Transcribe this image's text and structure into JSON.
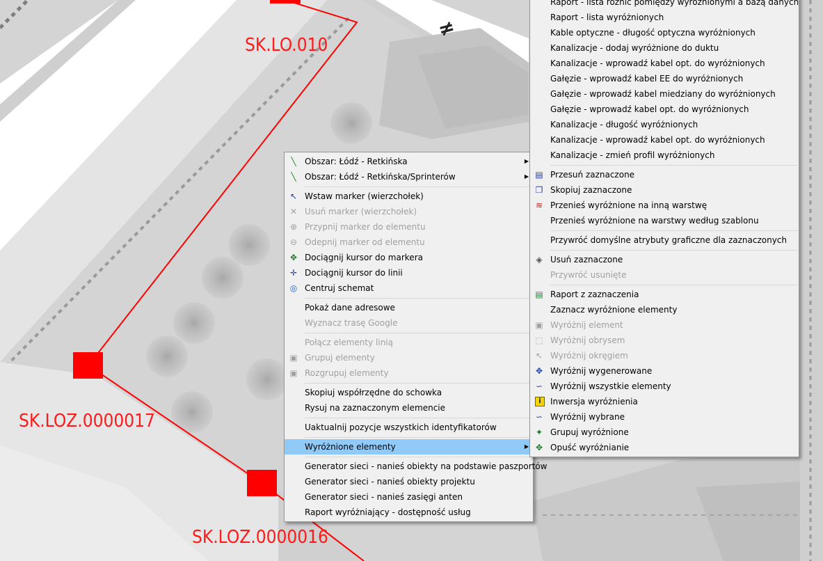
{
  "map": {
    "labels": [
      "SK.LO.010",
      "SK.LOZ.0000017",
      "SK.LOZ.0000016"
    ],
    "not_equal_symbol": "≠",
    "accent_color": "#ff0000"
  },
  "context_menu": {
    "items": [
      {
        "label": "Obszar: Łódź - Retkińska",
        "icon": "diagonal-line-icon",
        "glyph": "╲",
        "color": "#1a8a1a",
        "disabled": false,
        "submenu": true
      },
      {
        "label": "Obszar: Łódź - Retkińska/Sprinterów",
        "icon": "diagonal-line-icon",
        "glyph": "╲",
        "color": "#1a8a1a",
        "disabled": false,
        "submenu": true
      },
      {
        "separator": true
      },
      {
        "label": "Wstaw marker (wierzchołek)",
        "icon": "cursor-arrow-icon",
        "glyph": "↖",
        "color": "#1a3fa0",
        "disabled": false
      },
      {
        "label": "Usuń marker (wierzchołek)",
        "icon": "delete-x-icon",
        "glyph": "✕",
        "color": "#a0a0a0",
        "disabled": true
      },
      {
        "label": "Przypnij marker do elementu",
        "icon": "pin-marker-icon",
        "glyph": "⊕",
        "color": "#a0a0a0",
        "disabled": true
      },
      {
        "label": "Odepnij marker od elementu",
        "icon": "unpin-marker-icon",
        "glyph": "⊖",
        "color": "#a0a0a0",
        "disabled": true
      },
      {
        "label": "Dociągnij kursor do markera",
        "icon": "snap-to-marker-icon",
        "glyph": "✥",
        "color": "#1a7a2a",
        "disabled": false
      },
      {
        "label": "Dociągnij kursor do linii",
        "icon": "snap-to-line-icon",
        "glyph": "✛",
        "color": "#1a3fa0",
        "disabled": false
      },
      {
        "label": "Centruj schemat",
        "icon": "center-target-icon",
        "glyph": "◎",
        "color": "#1a5fd0",
        "disabled": false
      },
      {
        "separator": true
      },
      {
        "label": "Pokaż dane adresowe",
        "icon": "",
        "glyph": "",
        "disabled": false
      },
      {
        "label": "Wyznacz trasę Google",
        "icon": "",
        "glyph": "",
        "disabled": true
      },
      {
        "separator": true
      },
      {
        "label": "Połącz elementy linią",
        "icon": "",
        "glyph": "",
        "disabled": true
      },
      {
        "label": "Grupuj elementy",
        "icon": "group-icon",
        "glyph": "▣",
        "color": "#a0a0a0",
        "disabled": true
      },
      {
        "label": "Rozgrupuj elementy",
        "icon": "ungroup-icon",
        "glyph": "▣",
        "color": "#a0a0a0",
        "disabled": true
      },
      {
        "separator": true
      },
      {
        "label": "Skopiuj współrzędne do schowka",
        "icon": "",
        "glyph": "",
        "disabled": false
      },
      {
        "label": "Rysuj na zaznaczonym elemencie",
        "icon": "",
        "glyph": "",
        "disabled": false
      },
      {
        "separator": true
      },
      {
        "label": "Uaktualnij pozycje wszystkich identyfikatorów",
        "icon": "",
        "glyph": "",
        "disabled": false
      },
      {
        "separator": true
      },
      {
        "label": "Wyróżnione elementy",
        "icon": "",
        "glyph": "",
        "disabled": false,
        "submenu": true,
        "highlight": true
      },
      {
        "separator": true
      },
      {
        "label": "Generator sieci - nanieś obiekty na podstawie paszportów",
        "icon": "",
        "glyph": "",
        "disabled": false
      },
      {
        "label": "Generator sieci - nanieś obiekty projektu",
        "icon": "",
        "glyph": "",
        "disabled": false
      },
      {
        "label": "Generator sieci - nanieś zasięgi anten",
        "icon": "",
        "glyph": "",
        "disabled": false
      },
      {
        "label": "Raport wyróżniający - dostępność usług",
        "icon": "",
        "glyph": "",
        "disabled": false
      }
    ]
  },
  "submenu": {
    "items": [
      {
        "label": "Raport - lista różnic pomiędzy wyróżnionymi a bazą danych",
        "icon": "",
        "glyph": "",
        "disabled": false
      },
      {
        "label": "Raport - lista wyróżnionych",
        "icon": "",
        "glyph": "",
        "disabled": false
      },
      {
        "label": "Kable optyczne - długość optyczna wyróżnionych",
        "icon": "",
        "glyph": "",
        "disabled": false
      },
      {
        "label": "Kanalizacje - dodaj wyróżnione do duktu",
        "icon": "",
        "glyph": "",
        "disabled": false
      },
      {
        "label": "Kanalizacje - wprowadź kabel opt. do wyróżnionych",
        "icon": "",
        "glyph": "",
        "disabled": false
      },
      {
        "label": "Gałęzie - wprowadź kabel EE do wyróżnionych",
        "icon": "",
        "glyph": "",
        "disabled": false
      },
      {
        "label": "Gałęzie - wprowadź kabel miedziany do wyróżnionych",
        "icon": "",
        "glyph": "",
        "disabled": false
      },
      {
        "label": "Gałęzie - wprowadź kabel opt. do wyróżnionych",
        "icon": "",
        "glyph": "",
        "disabled": false
      },
      {
        "label": "Kanalizacje - długość wyróżnionych",
        "icon": "",
        "glyph": "",
        "disabled": false
      },
      {
        "label": "Kanalizacje - wprowadź kabel opt. do wyróżnionych",
        "icon": "",
        "glyph": "",
        "disabled": false
      },
      {
        "label": "Kanalizacje - zmień profil wyróżnionych",
        "icon": "",
        "glyph": "",
        "disabled": false
      },
      {
        "separator": true
      },
      {
        "label": "Przesuń zaznaczone",
        "icon": "move-doc-icon",
        "glyph": "▤",
        "color": "#2a3fa0",
        "disabled": false
      },
      {
        "label": "Skopiuj zaznaczone",
        "icon": "copy-doc-icon",
        "glyph": "❐",
        "color": "#2a3fa0",
        "disabled": false
      },
      {
        "label": "Przenieś wyróżnione na inną warstwę",
        "icon": "layers-icon",
        "glyph": "≋",
        "color": "#c02020",
        "disabled": false
      },
      {
        "label": "Przenieś wyróżnione na warstwy według szablonu",
        "icon": "",
        "glyph": "",
        "disabled": false
      },
      {
        "separator": true
      },
      {
        "label": "Przywróć domyślne atrybuty graficzne dla zaznaczonych",
        "icon": "",
        "glyph": "",
        "disabled": false
      },
      {
        "separator": true
      },
      {
        "label": "Usuń zaznaczone",
        "icon": "delete-cube-icon",
        "glyph": "◈",
        "color": "#505050",
        "disabled": false
      },
      {
        "label": "Przywróć usunięte",
        "icon": "",
        "glyph": "",
        "disabled": true
      },
      {
        "separator": true
      },
      {
        "label": "Raport z zaznaczenia",
        "icon": "report-icon",
        "glyph": "▤",
        "color": "#2a7a3a",
        "disabled": false
      },
      {
        "label": "Zaznacz wyróżnione elementy",
        "icon": "",
        "glyph": "",
        "disabled": false
      },
      {
        "label": "Wyróżnij element",
        "icon": "highlight-element-icon",
        "glyph": "▣",
        "color": "#a0a0a0",
        "disabled": true
      },
      {
        "label": "Wyróżnij obrysem",
        "icon": "highlight-outline-icon",
        "glyph": "⬚",
        "color": "#a0a0a0",
        "disabled": true
      },
      {
        "label": "Wyróżnij okręgiem",
        "icon": "highlight-circle-icon",
        "glyph": "↖",
        "color": "#a0a0a0",
        "disabled": true
      },
      {
        "label": "Wyróżnij wygenerowane",
        "icon": "highlight-generated-icon",
        "glyph": "✥",
        "color": "#1a3fa0",
        "disabled": false
      },
      {
        "label": "Wyróżnij wszystkie elementy",
        "icon": "highlight-all-icon",
        "glyph": "∽",
        "color": "#1a3fd0",
        "disabled": false
      },
      {
        "label": "Inwersja wyróżnienia",
        "icon": "invert-info-icon",
        "glyph": "i",
        "color": "#1a1a1a",
        "disabled": false
      },
      {
        "label": "Wyróżnij wybrane",
        "icon": "highlight-selected-icon",
        "glyph": "∽",
        "color": "#1a3fd0",
        "disabled": false
      },
      {
        "label": "Grupuj wyróżnione",
        "icon": "group-highlighted-icon",
        "glyph": "✦",
        "color": "#1a7a2a",
        "disabled": false
      },
      {
        "label": "Opuść wyróżnianie",
        "icon": "leave-highlight-icon",
        "glyph": "✥",
        "color": "#1a7a2a",
        "disabled": false
      }
    ]
  }
}
